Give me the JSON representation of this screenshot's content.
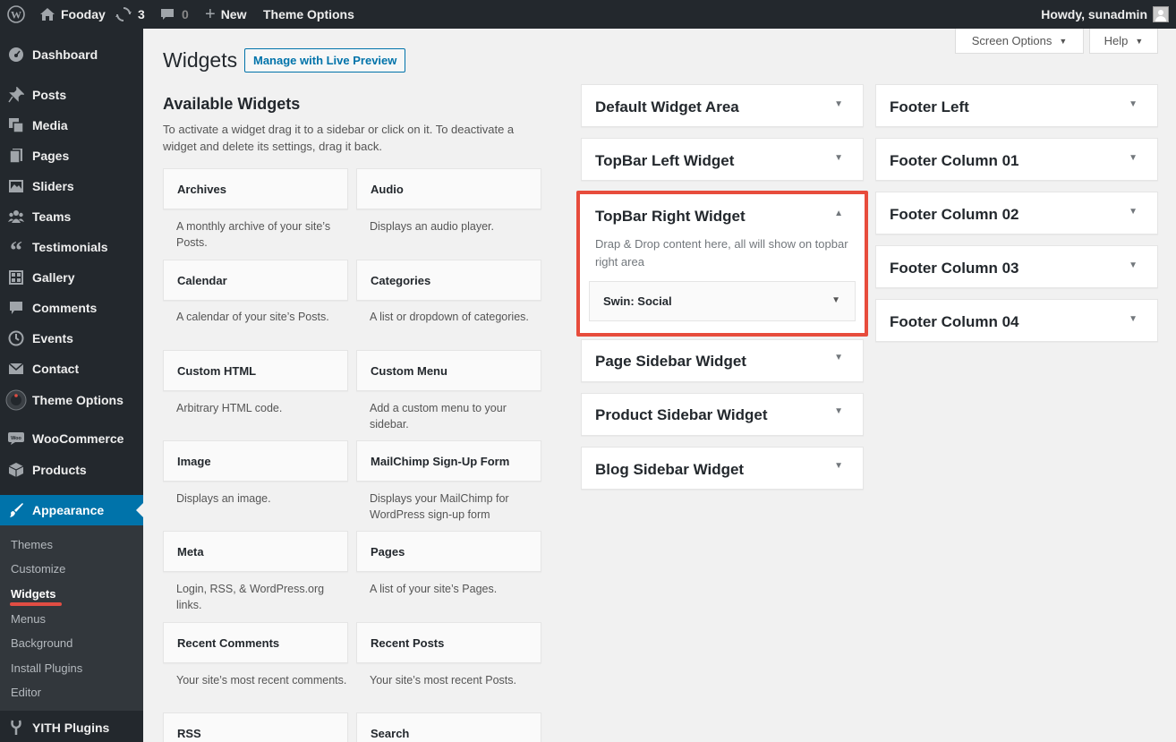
{
  "adminbar": {
    "site_name": "Fooday",
    "updates_count": "3",
    "comments_count": "0",
    "new_label": "New",
    "theme_options": "Theme Options",
    "howdy": "Howdy, sunadmin"
  },
  "sidebar": {
    "items": [
      {
        "label": "Dashboard",
        "icon": "dashboard-icon"
      },
      {
        "label": "Posts",
        "icon": "pin-icon"
      },
      {
        "label": "Media",
        "icon": "media-icon"
      },
      {
        "label": "Pages",
        "icon": "pages-icon"
      },
      {
        "label": "Sliders",
        "icon": "slider-icon"
      },
      {
        "label": "Teams",
        "icon": "groups-icon"
      },
      {
        "label": "Testimonials",
        "icon": "quote-icon"
      },
      {
        "label": "Gallery",
        "icon": "gallery-icon"
      },
      {
        "label": "Comments",
        "icon": "comment-icon"
      },
      {
        "label": "Events",
        "icon": "clock-icon"
      },
      {
        "label": "Contact",
        "icon": "email-icon"
      },
      {
        "label": "Theme Options",
        "icon": "theme-options-icon"
      },
      {
        "label": "WooCommerce",
        "icon": "woocommerce-icon"
      },
      {
        "label": "Products",
        "icon": "box-icon"
      },
      {
        "label": "Appearance",
        "icon": "brush-icon"
      },
      {
        "label": "YITH Plugins",
        "icon": "yith-icon"
      }
    ],
    "submenu": [
      "Themes",
      "Customize",
      "Widgets",
      "Menus",
      "Background",
      "Install Plugins",
      "Editor"
    ]
  },
  "header": {
    "title": "Widgets",
    "live_preview": "Manage with Live Preview",
    "screen_options": "Screen Options",
    "help": "Help"
  },
  "available": {
    "title": "Available Widgets",
    "description": "To activate a widget drag it to a sidebar or click on it. To deactivate a widget and delete its settings, drag it back.",
    "widgets": [
      {
        "name": "Archives",
        "desc": "A monthly archive of your site’s Posts."
      },
      {
        "name": "Audio",
        "desc": "Displays an audio player."
      },
      {
        "name": "Calendar",
        "desc": "A calendar of your site’s Posts."
      },
      {
        "name": "Categories",
        "desc": "A list or dropdown of categories."
      },
      {
        "name": "Custom HTML",
        "desc": "Arbitrary HTML code."
      },
      {
        "name": "Custom Menu",
        "desc": "Add a custom menu to your sidebar."
      },
      {
        "name": "Image",
        "desc": "Displays an image."
      },
      {
        "name": "MailChimp Sign-Up Form",
        "desc": "Displays your MailChimp for WordPress sign-up form"
      },
      {
        "name": "Meta",
        "desc": "Login, RSS, & WordPress.org links."
      },
      {
        "name": "Pages",
        "desc": "A list of your site’s Pages."
      },
      {
        "name": "Recent Comments",
        "desc": "Your site’s most recent comments."
      },
      {
        "name": "Recent Posts",
        "desc": "Your site’s most recent Posts."
      },
      {
        "name": "RSS",
        "desc": ""
      },
      {
        "name": "Search",
        "desc": ""
      }
    ]
  },
  "sidebars": {
    "col1": [
      "Default Widget Area",
      "TopBar Left Widget",
      "Page Sidebar Widget",
      "Product Sidebar Widget",
      "Blog Sidebar Widget"
    ],
    "col2": [
      "Footer Left",
      "Footer Column 01",
      "Footer Column 02",
      "Footer Column 03",
      "Footer Column 04"
    ],
    "open": {
      "title": "TopBar Right Widget",
      "description": "Drap & Drop content here, all will show on topbar right area",
      "widget": "Swin: Social"
    }
  },
  "colors": {
    "highlight": "#e74c3c",
    "accent": "#0073aa"
  }
}
